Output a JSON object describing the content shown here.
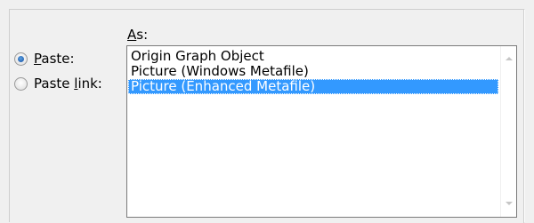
{
  "as_label": {
    "accel": "A",
    "rest": "s:"
  },
  "radios": {
    "paste": {
      "accel": "P",
      "rest": "aste:",
      "selected": true
    },
    "paste_link": {
      "pre": "Paste ",
      "accel": "l",
      "rest": "ink:",
      "selected": false
    }
  },
  "list": {
    "items": [
      "Origin Graph Object",
      "Picture (Windows Metafile)",
      "Picture (Enhanced Metafile)"
    ],
    "selected_index": 2,
    "selection_color": "#3399ff"
  },
  "icons": {
    "scroll_up": "triangle-up",
    "scroll_down": "triangle-down",
    "radio_dot": "filled-circle"
  }
}
